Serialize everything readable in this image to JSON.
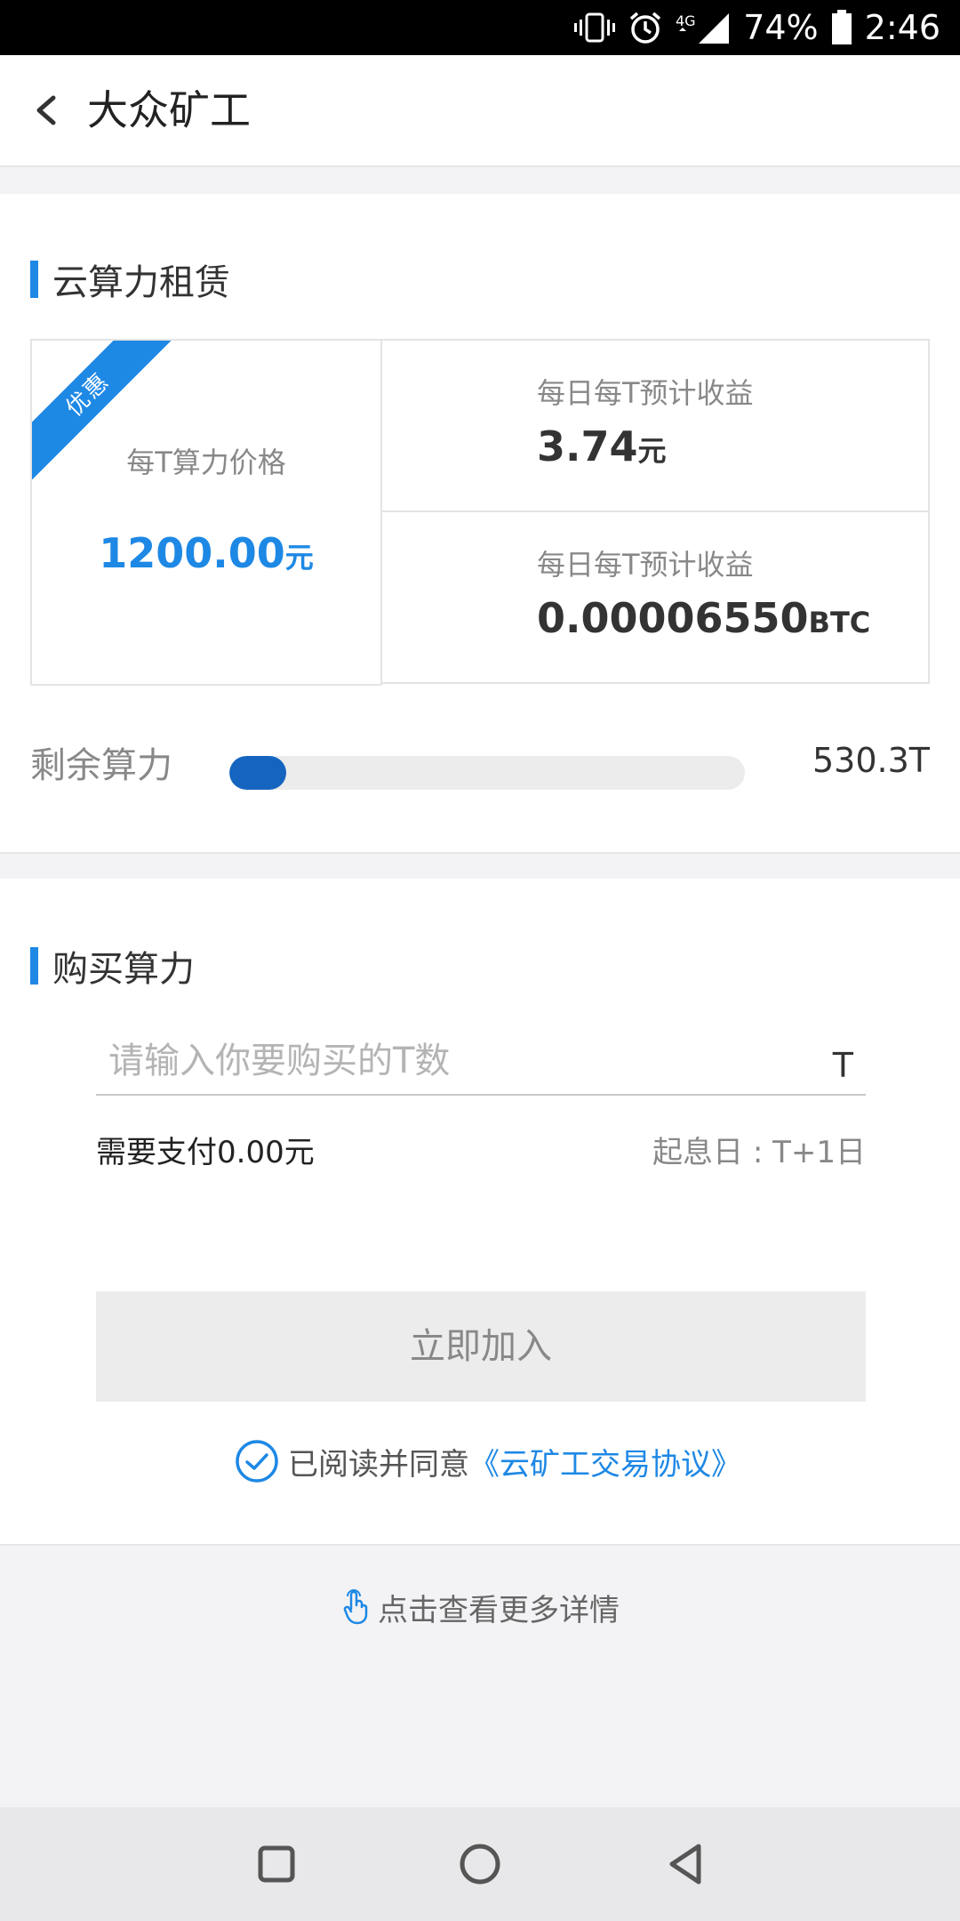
{
  "status_bar": {
    "battery": "74%",
    "time": "2:46",
    "network": "4G"
  },
  "header": {
    "title": "大众矿工"
  },
  "rental": {
    "section_title": "云算力租赁",
    "badge": "优惠",
    "price_label": "每T算力价格",
    "price_value": "1200.00",
    "price_unit": "元",
    "income_cny_label": "每日每T预计收益",
    "income_cny_value": "3.74",
    "income_cny_unit": "元",
    "income_btc_label": "每日每T预计收益",
    "income_btc_value": "0.00006550",
    "income_btc_unit": "BTC",
    "remain_label": "剩余算力",
    "remain_progress": 0.11,
    "remain_value": "530.3T"
  },
  "buy": {
    "section_title": "购买算力",
    "input_placeholder": "请输入你要购买的T数",
    "input_value": "",
    "input_unit": "T",
    "pay_text": "需要支付0.00元",
    "start_text": "起息日 : T+1日",
    "join_label": "立即加入",
    "agree_text": "已阅读并同意",
    "agree_link": "《云矿工交易协议》"
  },
  "more": {
    "label": "点击查看更多详情"
  },
  "colors": {
    "accent": "#1e88e5",
    "progress": "#1565c0"
  }
}
